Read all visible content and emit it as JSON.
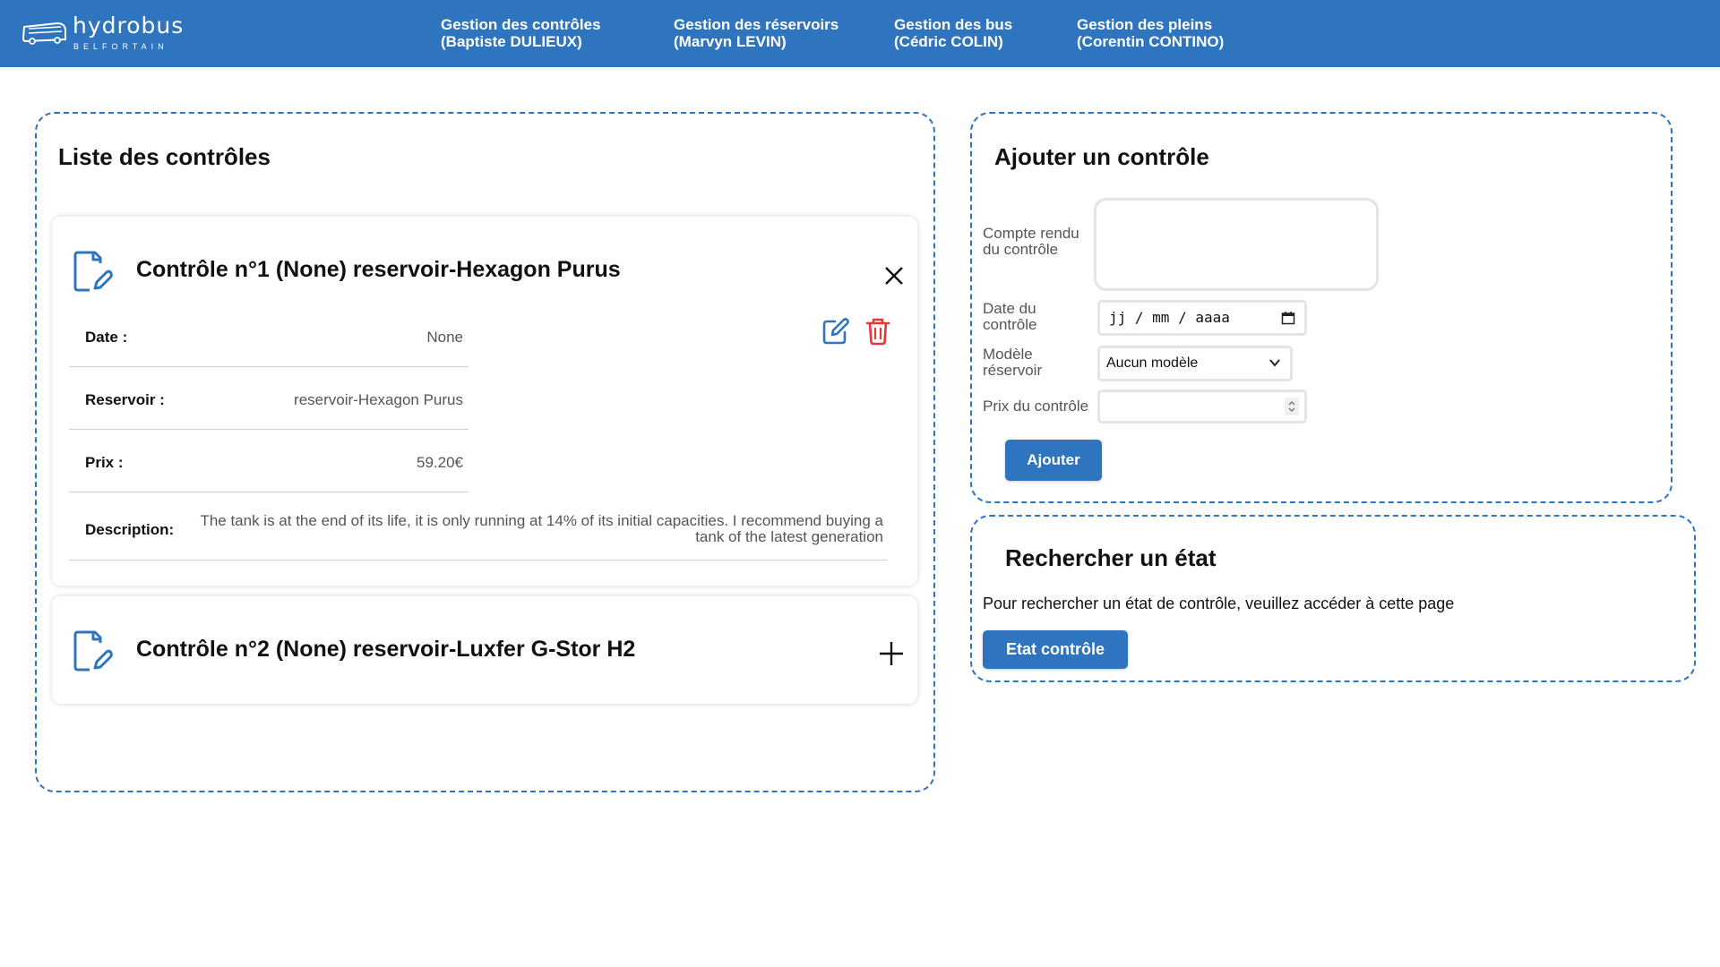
{
  "header": {
    "brand": "hydrobus",
    "city": "BELFORTAIN",
    "nav": [
      {
        "line1": "Gestion des contrôles",
        "line2": "(Baptiste DULIEUX)"
      },
      {
        "line1": "Gestion des réservoirs",
        "line2": "(Marvyn LEVIN)"
      },
      {
        "line1": "Gestion des bus",
        "line2": "(Cédric COLIN)"
      },
      {
        "line1": "Gestion des pleins",
        "line2": "(Corentin CONTINO)"
      }
    ]
  },
  "list": {
    "title": "Liste des contrôles",
    "cards": [
      {
        "title": "Contrôle n°1 (None) reservoir-Hexagon Purus",
        "expanded": true,
        "fields": [
          {
            "label": "Date :",
            "value": "None"
          },
          {
            "label": "Reservoir :",
            "value": "reservoir-Hexagon Purus"
          },
          {
            "label": "Prix :",
            "value": "59.20€"
          }
        ],
        "description_label": "Description:",
        "description_line1": "The tank is at the end of its life, it is only running at 14% of its initial capacities. I recommend buying a",
        "description_line2": "tank of the latest generation"
      },
      {
        "title": "Contrôle n°2 (None) reservoir-Luxfer G-Stor H2",
        "expanded": false
      }
    ]
  },
  "add_form": {
    "title": "Ajouter un contrôle",
    "report_label_1": "Compte rendu",
    "report_label_2": "du contrôle",
    "date_label_1": "Date du",
    "date_label_2": "contrôle",
    "date_placeholder": "jj / mm / aaaa",
    "model_label_1": "Modèle",
    "model_label_2": "réservoir",
    "model_selected": "Aucun modèle",
    "price_label": "Prix du contrôle",
    "submit": "Ajouter"
  },
  "search": {
    "title": "Rechercher un état",
    "text": "Pour rechercher un état de contrôle, veuillez accéder à cette page",
    "button": "Etat contrôle"
  },
  "colors": {
    "primary": "#2f74bf",
    "danger": "#e5383b",
    "edit": "#2f74bf"
  }
}
